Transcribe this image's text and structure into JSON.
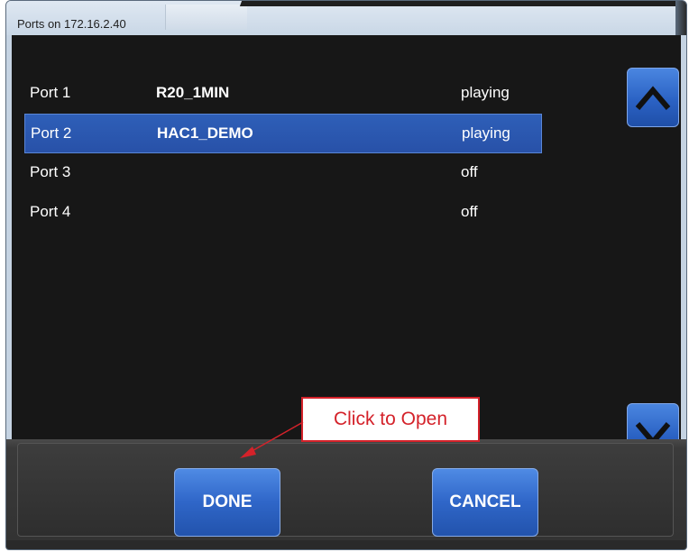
{
  "window": {
    "title": "Ports on 172.16.2.40"
  },
  "ports": [
    {
      "port": "Port 1",
      "name": "R20_1MIN",
      "status": "playing",
      "selected": false
    },
    {
      "port": "Port 2",
      "name": "HAC1_DEMO",
      "status": "playing",
      "selected": true
    },
    {
      "port": "Port 3",
      "name": "",
      "status": "off",
      "selected": false
    },
    {
      "port": "Port 4",
      "name": "",
      "status": "off",
      "selected": false
    }
  ],
  "scroll": {
    "up_icon": "chevron-up-icon",
    "down_icon": "chevron-down-icon"
  },
  "actions": {
    "done_label": "DONE",
    "cancel_label": "CANCEL"
  },
  "annotation": {
    "callout_text": "Click to Open"
  },
  "colors": {
    "list_background": "#171717",
    "selection": "#2e5fb8",
    "button_blue": "#2f66c8",
    "callout_red": "#d4222a"
  }
}
